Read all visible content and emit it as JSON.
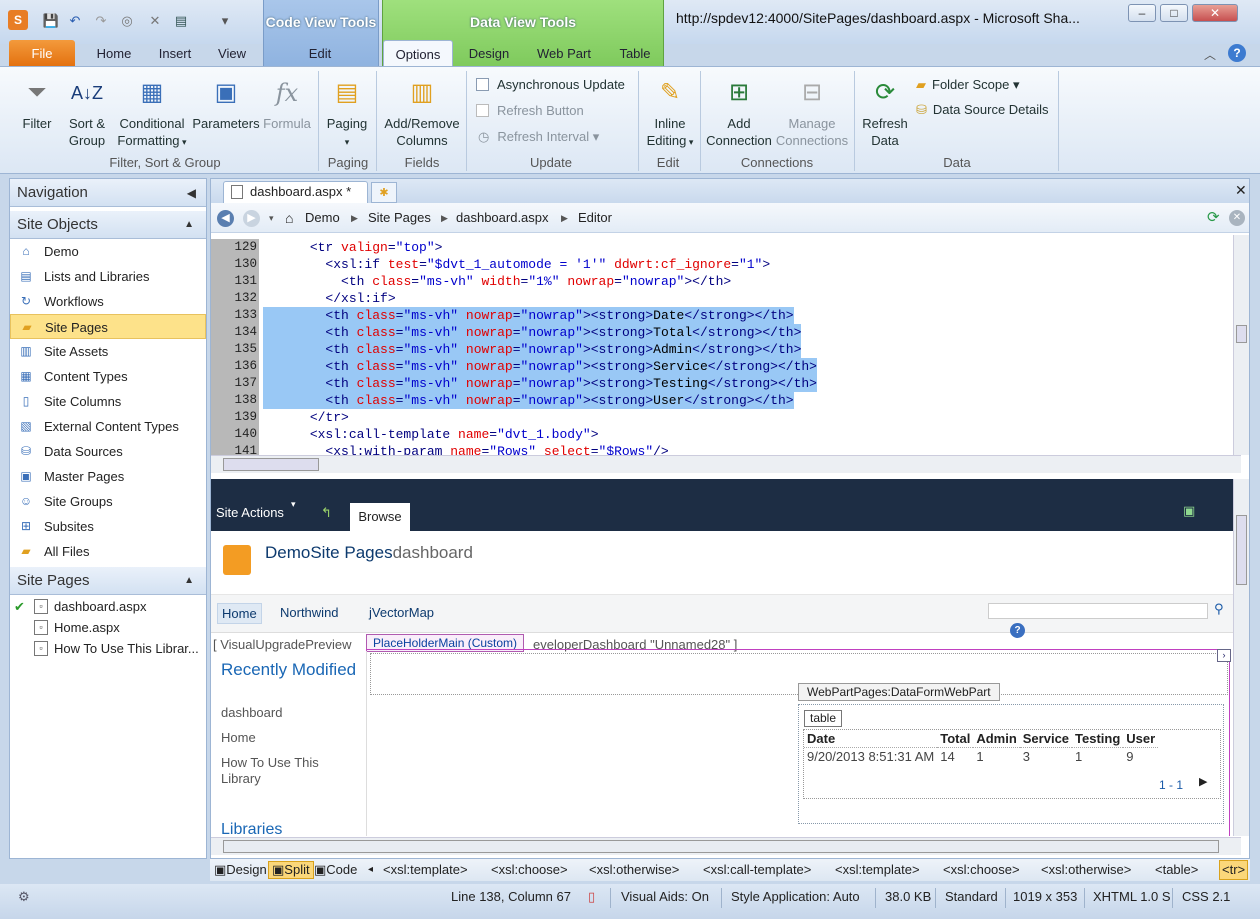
{
  "window": {
    "title": "http://spdev12:4000/SitePages/dashboard.aspx - Microsoft Sha...",
    "context_code_view": "Code View Tools",
    "context_data_view": "Data View Tools"
  },
  "tabs": [
    "File",
    "Home",
    "Insert",
    "View",
    "Edit",
    "Options",
    "Design",
    "Web Part",
    "Table"
  ],
  "ribbon": {
    "groups": {
      "filter": "Filter, Sort & Group",
      "paging": "Paging",
      "fields": "Fields",
      "update": "Update",
      "edit": "Edit",
      "connections": "Connections",
      "data": "Data"
    },
    "buttons": {
      "filter": "Filter",
      "sort1": "Sort &",
      "sort2": "Group",
      "cond1": "Conditional",
      "cond2": "Formatting",
      "parameters": "Parameters",
      "formula": "Formula",
      "paging": "Paging",
      "addrem1": "Add/Remove",
      "addrem2": "Columns",
      "async": "Asynchronous Update",
      "refresh_button": "Refresh Button",
      "refresh_interval": "Refresh Interval",
      "inline1": "Inline",
      "inline2": "Editing",
      "addconn1": "Add",
      "addconn2": "Connection",
      "manage1": "Manage",
      "manage2": "Connections",
      "refreshdata1": "Refresh",
      "refreshdata2": "Data",
      "folder_scope": "Folder Scope",
      "data_source_details": "Data Source Details"
    }
  },
  "navigation": {
    "title": "Navigation",
    "site_objects_title": "Site Objects",
    "site_objects": [
      {
        "label": "Demo",
        "icon": "home-icon"
      },
      {
        "label": "Lists and Libraries",
        "icon": "list-icon"
      },
      {
        "label": "Workflows",
        "icon": "workflow-icon"
      },
      {
        "label": "Site Pages",
        "icon": "folder-icon"
      },
      {
        "label": "Site Assets",
        "icon": "assets-icon"
      },
      {
        "label": "Content Types",
        "icon": "content-types-icon"
      },
      {
        "label": "Site Columns",
        "icon": "columns-icon"
      },
      {
        "label": "External Content Types",
        "icon": "external-icon"
      },
      {
        "label": "Data Sources",
        "icon": "database-icon"
      },
      {
        "label": "Master Pages",
        "icon": "master-icon"
      },
      {
        "label": "Site Groups",
        "icon": "groups-icon"
      },
      {
        "label": "Subsites",
        "icon": "subsites-icon"
      },
      {
        "label": "All Files",
        "icon": "folder-icon"
      }
    ],
    "site_pages_title": "Site Pages",
    "site_pages": [
      "dashboard.aspx",
      "Home.aspx",
      "How To Use This Librar..."
    ]
  },
  "editor": {
    "doc_tab": "dashboard.aspx *",
    "breadcrumb": [
      "Demo",
      "Site Pages",
      "dashboard.aspx",
      "Editor"
    ],
    "line_numbers": [
      "129",
      "130",
      "131",
      "132",
      "133",
      "134",
      "135",
      "136",
      "137",
      "138",
      "139",
      "140",
      "141"
    ]
  },
  "sp_page": {
    "site_actions": "Site Actions",
    "browse": "Browse",
    "title_site": "DemoSite Pages",
    "title_page": "dashboard",
    "nav": [
      "Home",
      "Northwind",
      "jVectorMap"
    ],
    "control_strip": "[ VisualUpgradePreview",
    "control_strip_right": "eveloperDashboard \"Unnamed28\" ]",
    "placeholder": "PlaceHolderMain (Custom)",
    "recently_modified": "Recently Modified",
    "recent_items": [
      "dashboard",
      "Home",
      "How To Use This Library"
    ],
    "libraries": "Libraries",
    "webpart_tag": "WebPartPages:DataFormWebPart",
    "table_tag": "table",
    "table_headers": [
      "Date",
      "Total",
      "Admin",
      "Service",
      "Testing",
      "User"
    ],
    "table_row": [
      "9/20/2013 8:51:31 AM",
      "14",
      "1",
      "3",
      "1",
      "9"
    ],
    "paging": "1 - 1"
  },
  "tagbar": {
    "views": [
      "Design",
      "Split",
      "Code"
    ],
    "tags": [
      "<xsl:template>",
      "<xsl:choose>",
      "<xsl:otherwise>",
      "<xsl:call-template>",
      "<xsl:template>",
      "<xsl:choose>",
      "<xsl:otherwise>",
      "<table>",
      "<tr>"
    ]
  },
  "status": {
    "position": "Line 138, Column 67",
    "visual_aids": "Visual Aids: On",
    "style_app": "Style Application: Auto",
    "size": "38.0 KB",
    "mode": "Standard",
    "dimensions": "1019 x 353",
    "doctype": "XHTML 1.0 S",
    "css": "CSS 2.1"
  }
}
